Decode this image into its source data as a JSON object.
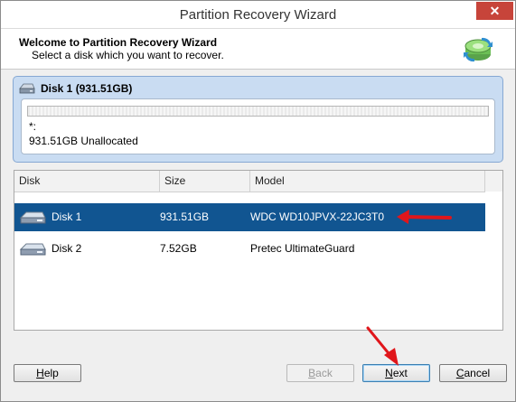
{
  "window": {
    "title": "Partition Recovery Wizard",
    "close_glyph": "✕"
  },
  "header": {
    "title": "Welcome to Partition Recovery Wizard",
    "subtitle": "Select a disk which you want to recover.",
    "icon": "wizard-disk-icon"
  },
  "disk_panel": {
    "title": "Disk 1 (931.51GB)",
    "partition_label": "*:",
    "partition_info": "931.51GB Unallocated"
  },
  "table": {
    "columns": [
      "Disk",
      "Size",
      "Model"
    ],
    "rows": [
      {
        "disk": "Disk 1",
        "size": "931.51GB",
        "model": "WDC WD10JPVX-22JC3T0",
        "selected": true
      },
      {
        "disk": "Disk 2",
        "size": "7.52GB",
        "model": "Pretec  UltimateGuard",
        "selected": false
      }
    ]
  },
  "buttons": {
    "help": {
      "prefix": "",
      "hotkey": "H",
      "suffix": "elp"
    },
    "back": {
      "prefix": "",
      "hotkey": "B",
      "suffix": "ack"
    },
    "next": {
      "prefix": "",
      "hotkey": "N",
      "suffix": "ext"
    },
    "cancel": {
      "prefix": "",
      "hotkey": "C",
      "suffix": "ancel"
    }
  },
  "colors": {
    "selection": "#115591",
    "annotation_arrow": "#e0161b",
    "close_button": "#c7443a"
  }
}
